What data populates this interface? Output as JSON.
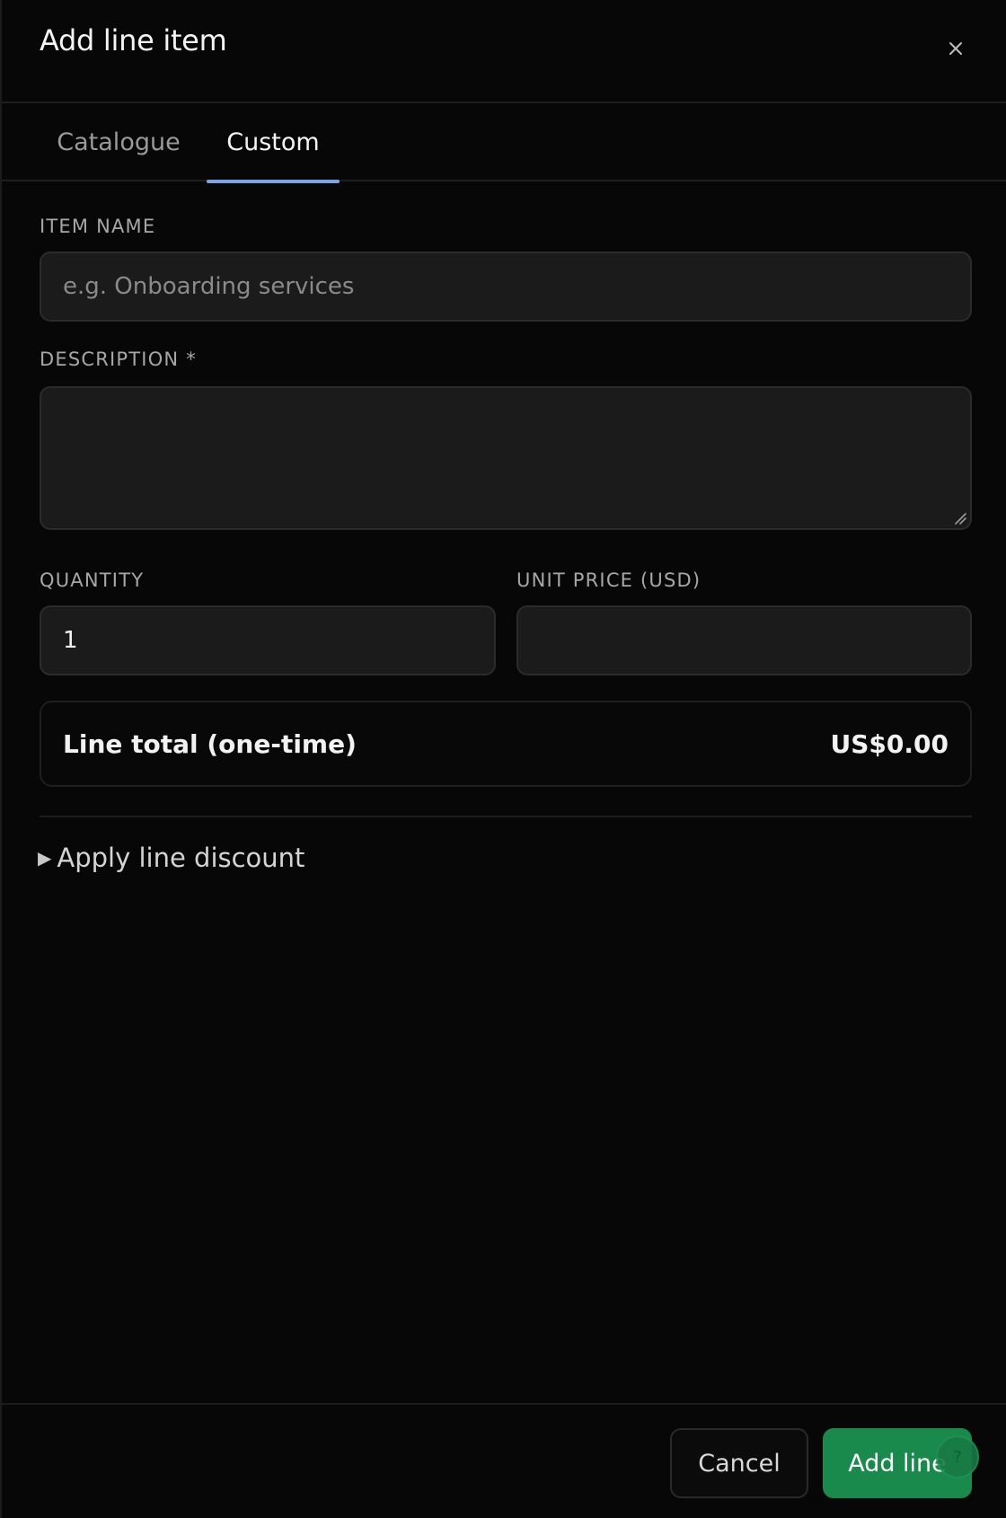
{
  "dialog": {
    "title": "Add line item",
    "close_icon": "close-icon"
  },
  "tabs": [
    {
      "label": "Catalogue",
      "active": false
    },
    {
      "label": "Custom",
      "active": true
    }
  ],
  "form": {
    "item_name": {
      "label": "ITEM NAME",
      "placeholder": "e.g. Onboarding services",
      "value": ""
    },
    "description": {
      "label": "DESCRIPTION *",
      "value": ""
    },
    "quantity": {
      "label": "QUANTITY",
      "value": "1"
    },
    "unit_price": {
      "label": "UNIT PRICE (USD)",
      "value": ""
    }
  },
  "line_total": {
    "label": "Line total (one-time)",
    "value": "US$0.00"
  },
  "discount": {
    "label": "Apply line discount",
    "icon": "triangle-right-icon"
  },
  "footer": {
    "cancel_label": "Cancel",
    "add_label": "Add line",
    "help_badge": "?"
  },
  "colors": {
    "background": "#070707",
    "accent_tab": "#7ea2e6",
    "primary_button": "#1a8a4c"
  }
}
